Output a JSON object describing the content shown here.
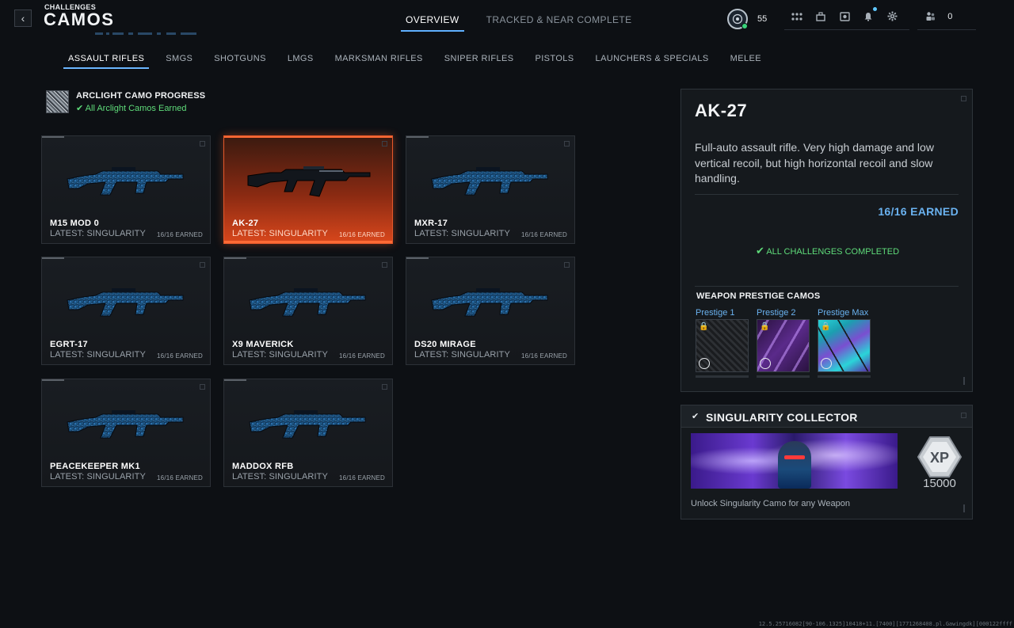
{
  "header": {
    "supertitle": "CHALLENGES",
    "title": "CAMOS",
    "back_icon": "chevron-left-icon",
    "tabs": [
      {
        "label": "OVERVIEW",
        "active": true
      },
      {
        "label": "TRACKED & NEAR COMPLETE",
        "active": false
      }
    ],
    "player_level": "55",
    "friends_online": "0"
  },
  "categories": [
    {
      "label": "ASSAULT RIFLES",
      "active": true
    },
    {
      "label": "SMGS"
    },
    {
      "label": "SHOTGUNS"
    },
    {
      "label": "LMGS"
    },
    {
      "label": "MARKSMAN RIFLES"
    },
    {
      "label": "SNIPER RIFLES"
    },
    {
      "label": "PISTOLS"
    },
    {
      "label": "LAUNCHERS & SPECIALS"
    },
    {
      "label": "MELEE"
    }
  ],
  "arclight": {
    "title": "ARCLIGHT CAMO PROGRESS",
    "status": "All Arclight Camos Earned"
  },
  "weapons": [
    {
      "name": "M15 MOD 0",
      "latest": "LATEST: SINGULARITY",
      "earned": "16/16 EARNED"
    },
    {
      "name": "AK-27",
      "latest": "LATEST: SINGULARITY",
      "earned": "16/16 EARNED",
      "selected": true
    },
    {
      "name": "MXR-17",
      "latest": "LATEST: SINGULARITY",
      "earned": "16/16 EARNED"
    },
    {
      "name": "EGRT-17",
      "latest": "LATEST: SINGULARITY",
      "earned": "16/16 EARNED"
    },
    {
      "name": "X9 MAVERICK",
      "latest": "LATEST: SINGULARITY",
      "earned": "16/16 EARNED"
    },
    {
      "name": "DS20 MIRAGE",
      "latest": "LATEST: SINGULARITY",
      "earned": "16/16 EARNED"
    },
    {
      "name": "PEACEKEEPER MK1",
      "latest": "LATEST: SINGULARITY",
      "earned": "16/16 EARNED"
    },
    {
      "name": "MADDOX RFB",
      "latest": "LATEST: SINGULARITY",
      "earned": "16/16 EARNED"
    }
  ],
  "detail": {
    "weapon_name": "AK-27",
    "description": "Full-auto assault rifle. Very high damage and low vertical recoil, but high horizontal recoil and slow handling.",
    "earned": "16/16 EARNED",
    "all_challenges": "ALL CHALLENGES COMPLETED",
    "prestige_title": "WEAPON PRESTIGE CAMOS",
    "prestige_camos": [
      {
        "label": "Prestige 1",
        "locked": true
      },
      {
        "label": "Prestige 2",
        "locked": true
      },
      {
        "label": "Prestige Max",
        "locked": true
      }
    ]
  },
  "reward": {
    "title": "SINGULARITY COLLECTOR",
    "xp_label": "XP",
    "xp_value": "15000",
    "unlock_text": "Unlock Singularity Camo for any Weapon"
  },
  "build_info": "12.5.25716082[90-106.1325]10418+11.[7400][1771268408.pl.Gawingdk][000122ffff",
  "colors": {
    "accent_blue": "#6ab2f0",
    "selected_orange": "#e5582a",
    "success_green": "#5fdc7a",
    "background": "#0d1014"
  }
}
